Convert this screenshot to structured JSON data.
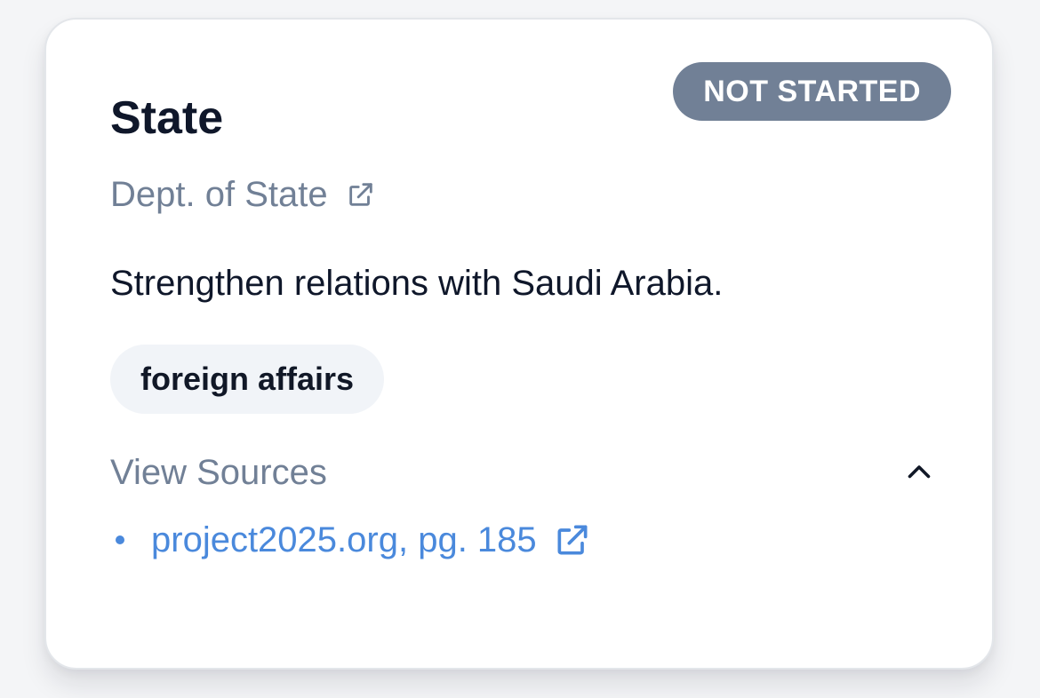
{
  "card": {
    "title": "State",
    "status": "NOT STARTED",
    "department": {
      "label": "Dept. of State",
      "icon": "external-link-icon"
    },
    "description": "Strengthen relations with Saudi Arabia.",
    "tags": [
      "foreign affairs"
    ],
    "sources": {
      "toggle_label": "View Sources",
      "toggle_icon": "chevron-up-icon",
      "expanded": true,
      "items": [
        {
          "label": "project2025.org, pg. 185",
          "icon": "external-link-icon"
        }
      ]
    }
  },
  "colors": {
    "status_badge_bg": "#718096",
    "muted_text": "#718096",
    "link": "#4a89dc",
    "tag_bg": "#f1f4f8",
    "title_text": "#0f172a"
  }
}
